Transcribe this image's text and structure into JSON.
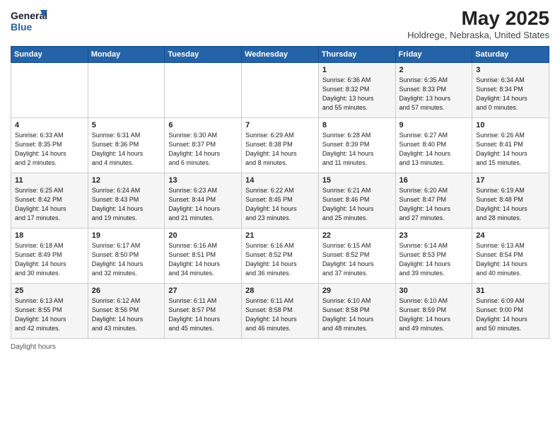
{
  "header": {
    "logo_line1": "General",
    "logo_line2": "Blue",
    "title": "May 2025",
    "subtitle": "Holdrege, Nebraska, United States"
  },
  "days_of_week": [
    "Sunday",
    "Monday",
    "Tuesday",
    "Wednesday",
    "Thursday",
    "Friday",
    "Saturday"
  ],
  "weeks": [
    [
      {
        "day": "",
        "info": ""
      },
      {
        "day": "",
        "info": ""
      },
      {
        "day": "",
        "info": ""
      },
      {
        "day": "",
        "info": ""
      },
      {
        "day": "1",
        "info": "Sunrise: 6:36 AM\nSunset: 8:32 PM\nDaylight: 13 hours\nand 55 minutes."
      },
      {
        "day": "2",
        "info": "Sunrise: 6:35 AM\nSunset: 8:33 PM\nDaylight: 13 hours\nand 57 minutes."
      },
      {
        "day": "3",
        "info": "Sunrise: 6:34 AM\nSunset: 8:34 PM\nDaylight: 14 hours\nand 0 minutes."
      }
    ],
    [
      {
        "day": "4",
        "info": "Sunrise: 6:33 AM\nSunset: 8:35 PM\nDaylight: 14 hours\nand 2 minutes."
      },
      {
        "day": "5",
        "info": "Sunrise: 6:31 AM\nSunset: 8:36 PM\nDaylight: 14 hours\nand 4 minutes."
      },
      {
        "day": "6",
        "info": "Sunrise: 6:30 AM\nSunset: 8:37 PM\nDaylight: 14 hours\nand 6 minutes."
      },
      {
        "day": "7",
        "info": "Sunrise: 6:29 AM\nSunset: 8:38 PM\nDaylight: 14 hours\nand 8 minutes."
      },
      {
        "day": "8",
        "info": "Sunrise: 6:28 AM\nSunset: 8:39 PM\nDaylight: 14 hours\nand 11 minutes."
      },
      {
        "day": "9",
        "info": "Sunrise: 6:27 AM\nSunset: 8:40 PM\nDaylight: 14 hours\nand 13 minutes."
      },
      {
        "day": "10",
        "info": "Sunrise: 6:26 AM\nSunset: 8:41 PM\nDaylight: 14 hours\nand 15 minutes."
      }
    ],
    [
      {
        "day": "11",
        "info": "Sunrise: 6:25 AM\nSunset: 8:42 PM\nDaylight: 14 hours\nand 17 minutes."
      },
      {
        "day": "12",
        "info": "Sunrise: 6:24 AM\nSunset: 8:43 PM\nDaylight: 14 hours\nand 19 minutes."
      },
      {
        "day": "13",
        "info": "Sunrise: 6:23 AM\nSunset: 8:44 PM\nDaylight: 14 hours\nand 21 minutes."
      },
      {
        "day": "14",
        "info": "Sunrise: 6:22 AM\nSunset: 8:45 PM\nDaylight: 14 hours\nand 23 minutes."
      },
      {
        "day": "15",
        "info": "Sunrise: 6:21 AM\nSunset: 8:46 PM\nDaylight: 14 hours\nand 25 minutes."
      },
      {
        "day": "16",
        "info": "Sunrise: 6:20 AM\nSunset: 8:47 PM\nDaylight: 14 hours\nand 27 minutes."
      },
      {
        "day": "17",
        "info": "Sunrise: 6:19 AM\nSunset: 8:48 PM\nDaylight: 14 hours\nand 28 minutes."
      }
    ],
    [
      {
        "day": "18",
        "info": "Sunrise: 6:18 AM\nSunset: 8:49 PM\nDaylight: 14 hours\nand 30 minutes."
      },
      {
        "day": "19",
        "info": "Sunrise: 6:17 AM\nSunset: 8:50 PM\nDaylight: 14 hours\nand 32 minutes."
      },
      {
        "day": "20",
        "info": "Sunrise: 6:16 AM\nSunset: 8:51 PM\nDaylight: 14 hours\nand 34 minutes."
      },
      {
        "day": "21",
        "info": "Sunrise: 6:16 AM\nSunset: 8:52 PM\nDaylight: 14 hours\nand 36 minutes."
      },
      {
        "day": "22",
        "info": "Sunrise: 6:15 AM\nSunset: 8:52 PM\nDaylight: 14 hours\nand 37 minutes."
      },
      {
        "day": "23",
        "info": "Sunrise: 6:14 AM\nSunset: 8:53 PM\nDaylight: 14 hours\nand 39 minutes."
      },
      {
        "day": "24",
        "info": "Sunrise: 6:13 AM\nSunset: 8:54 PM\nDaylight: 14 hours\nand 40 minutes."
      }
    ],
    [
      {
        "day": "25",
        "info": "Sunrise: 6:13 AM\nSunset: 8:55 PM\nDaylight: 14 hours\nand 42 minutes."
      },
      {
        "day": "26",
        "info": "Sunrise: 6:12 AM\nSunset: 8:56 PM\nDaylight: 14 hours\nand 43 minutes."
      },
      {
        "day": "27",
        "info": "Sunrise: 6:11 AM\nSunset: 8:57 PM\nDaylight: 14 hours\nand 45 minutes."
      },
      {
        "day": "28",
        "info": "Sunrise: 6:11 AM\nSunset: 8:58 PM\nDaylight: 14 hours\nand 46 minutes."
      },
      {
        "day": "29",
        "info": "Sunrise: 6:10 AM\nSunset: 8:58 PM\nDaylight: 14 hours\nand 48 minutes."
      },
      {
        "day": "30",
        "info": "Sunrise: 6:10 AM\nSunset: 8:59 PM\nDaylight: 14 hours\nand 49 minutes."
      },
      {
        "day": "31",
        "info": "Sunrise: 6:09 AM\nSunset: 9:00 PM\nDaylight: 14 hours\nand 50 minutes."
      }
    ]
  ],
  "footer": {
    "daylight_label": "Daylight hours"
  }
}
